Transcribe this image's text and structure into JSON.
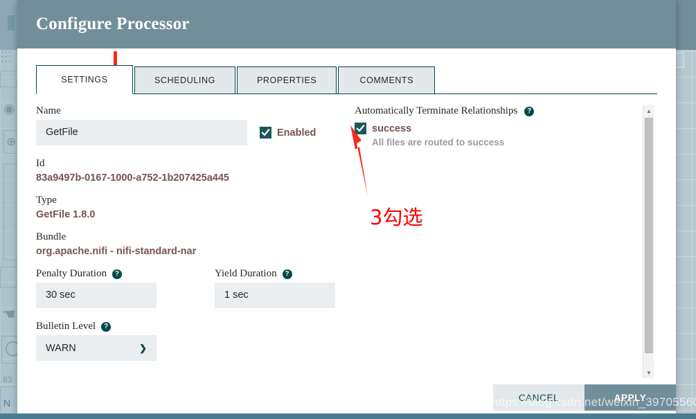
{
  "dialog": {
    "title": "Configure Processor",
    "tabs": [
      {
        "label": "SETTINGS",
        "active": true
      },
      {
        "label": "SCHEDULING",
        "active": false
      },
      {
        "label": "PROPERTIES",
        "active": false
      },
      {
        "label": "COMMENTS",
        "active": false
      }
    ],
    "settings": {
      "name_label": "Name",
      "name_value": "GetFile",
      "enabled_label": "Enabled",
      "enabled_checked": true,
      "id_label": "Id",
      "id_value": "83a9497b-0167-1000-a752-1b207425a445",
      "type_label": "Type",
      "type_value": "GetFile 1.8.0",
      "bundle_label": "Bundle",
      "bundle_value": "org.apache.nifi - nifi-standard-nar",
      "penalty_label": "Penalty Duration",
      "penalty_value": "30 sec",
      "yield_label": "Yield Duration",
      "yield_value": "1 sec",
      "bulletin_label": "Bulletin Level",
      "bulletin_value": "WARN",
      "help_glyph": "?"
    },
    "relationships": {
      "title": "Automatically Terminate Relationships",
      "items": [
        {
          "name": "success",
          "description": "All files are routed to success",
          "checked": true
        }
      ]
    },
    "footer": {
      "cancel_label": "CANCEL",
      "apply_label": "APPLY"
    }
  },
  "annotations": {
    "step_note": "3勾选"
  },
  "watermark": {
    "text": "https://blog.csdn.net/weixin_39705560"
  },
  "background": {
    "id_fragment": "83",
    "name_fragment": "N"
  },
  "colors": {
    "header": "#728e9b",
    "accent": "#004849",
    "checkbox": "#1c5659",
    "value_text": "#775351",
    "annotation": "#ff0000",
    "input_bg": "#eaeef0"
  }
}
